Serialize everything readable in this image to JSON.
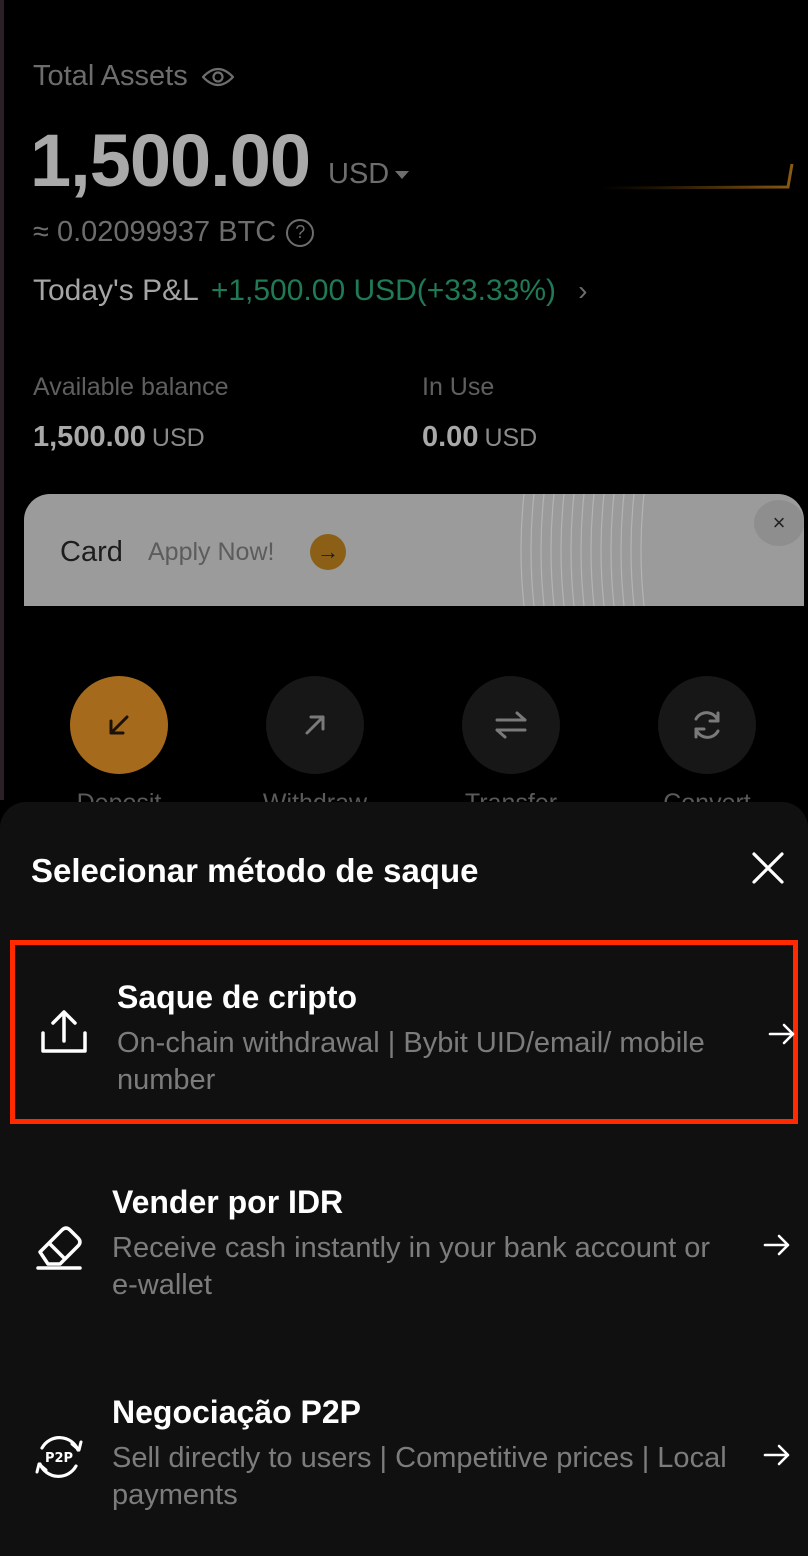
{
  "assets": {
    "label": "Total Assets",
    "amount": "1,500.00",
    "currency": "USD",
    "btc": "≈ 0.02099937 BTC",
    "pnl_label": "Today's P&L",
    "pnl_value": "+1,500.00 USD(+33.33%)"
  },
  "balances": {
    "available_label": "Available balance",
    "available_value": "1,500.00",
    "available_unit": "USD",
    "inuse_label": "In Use",
    "inuse_value": "0.00",
    "inuse_unit": "USD"
  },
  "card_banner": {
    "title": "Card",
    "cta": "Apply Now!"
  },
  "actions": [
    {
      "label": "Deposit",
      "icon": "arrow-down-left-icon"
    },
    {
      "label": "Withdraw",
      "icon": "arrow-up-right-icon"
    },
    {
      "label": "Transfer",
      "icon": "swap-arrows-icon"
    },
    {
      "label": "Convert",
      "icon": "refresh-icon"
    }
  ],
  "sheet": {
    "title": "Selecionar método de saque",
    "options": [
      {
        "title": "Saque de cripto",
        "description": "On-chain withdrawal | Bybit UID/email/ mobile number",
        "icon": "upload-icon"
      },
      {
        "title": "Vender por IDR",
        "description": "Receive cash instantly in your bank account or e-wallet",
        "icon": "eraser-tag-icon"
      },
      {
        "title": "Negociação P2P",
        "description": "Sell directly to users | Competitive prices | Local payments",
        "icon": "p2p-icon",
        "icon_text": "P2P"
      }
    ]
  },
  "colors": {
    "accent": "#f7a600",
    "profit": "#20b26c",
    "highlight": "#ff2a00",
    "sheet_bg": "#101010"
  }
}
